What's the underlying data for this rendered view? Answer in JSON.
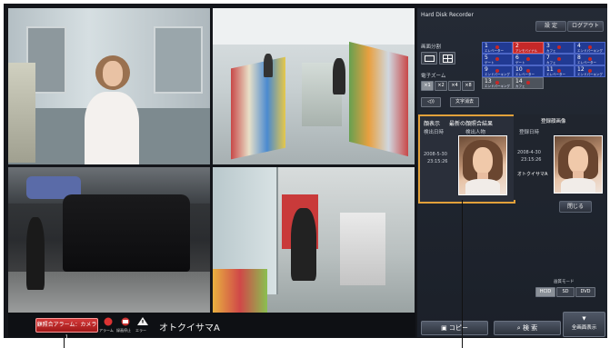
{
  "panel": {
    "title": "Hard Disk Recorder",
    "settings_label": "設 定",
    "logout_label": "ログアウト",
    "screen_split_label": "画面分割",
    "zoom_label": "電子ズーム",
    "zoom_options": [
      "×1",
      "×2",
      "×4",
      "×8"
    ],
    "audio_label": "◁))",
    "text_clear_label": "文字消去",
    "cameras": [
      {
        "num": "1",
        "name": "エレベーター",
        "state": "normal",
        "rec": true
      },
      {
        "num": "2",
        "name": "アンモバイナル",
        "state": "alarm",
        "rec": true
      },
      {
        "num": "3",
        "name": "カフェ",
        "state": "normal",
        "rec": true
      },
      {
        "num": "4",
        "name": "エンドパーキング",
        "state": "normal",
        "rec": true
      },
      {
        "num": "5",
        "name": "ゲート",
        "state": "normal",
        "rec": true
      },
      {
        "num": "6",
        "name": "ゲート",
        "state": "normal",
        "rec": true
      },
      {
        "num": "7",
        "name": "カフェ",
        "state": "normal",
        "rec": true
      },
      {
        "num": "8",
        "name": "エレベーター",
        "state": "normal",
        "rec": true
      },
      {
        "num": "9",
        "name": "エンドパーキング",
        "state": "normal",
        "rec": true
      },
      {
        "num": "10",
        "name": "エレベーター",
        "state": "normal",
        "rec": true
      },
      {
        "num": "11",
        "name": "エレベーター",
        "state": "normal",
        "rec": true
      },
      {
        "num": "12",
        "name": "エンドパーキング",
        "state": "normal",
        "rec": true
      },
      {
        "num": "13",
        "name": "エンドパーキング",
        "state": "gray",
        "rec": true
      },
      {
        "num": "14",
        "name": "カフェ",
        "state": "gray",
        "rec": true
      }
    ],
    "face_section": {
      "tab_label": "顔表示",
      "latest_label": "最新の顔照合結果",
      "col_time": "検出日時",
      "col_detected": "検出人物",
      "col_registered": "登録顔画像",
      "detect_date": "2008-5-30",
      "detect_time": "23:15:26",
      "registered_header": "登録日時",
      "reg_date": "2008-4-30",
      "reg_time": "23:15:26",
      "person_name": "オトクイサマA",
      "close_label": "閉じる"
    },
    "quality_label": "画質モード",
    "quality_options": [
      "HCID",
      "SD",
      "DVD"
    ],
    "copy_label": "コピー",
    "search_label": "検 索",
    "fullscreen_label": "全画面表示"
  },
  "bottom": {
    "alarm_label": "顧照合アラーム：カメラ1",
    "icon_labels": [
      "アラーム",
      "録画停止",
      "エラー"
    ],
    "person_name": "オトクイサマA"
  }
}
